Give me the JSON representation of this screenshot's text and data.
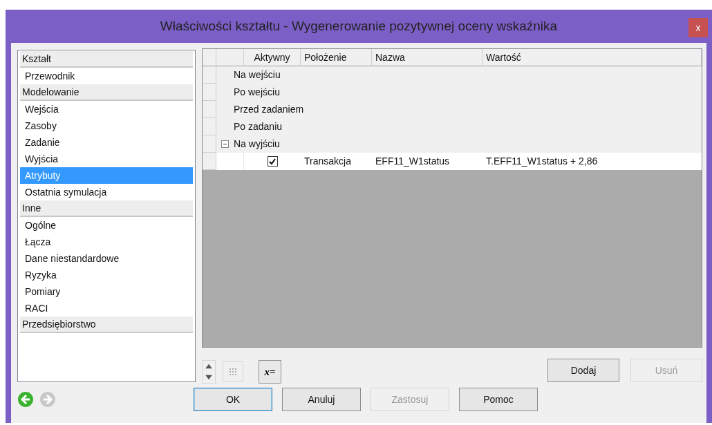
{
  "window": {
    "title": "Właściwości kształtu - Wygenerowanie pozytywnej oceny wskaźnika",
    "close": "x"
  },
  "sidebar": {
    "sections": [
      {
        "label": "Kształt",
        "items": [
          {
            "label": "Przewodnik",
            "selected": false
          }
        ]
      },
      {
        "label": "Modelowanie",
        "items": [
          {
            "label": "Wejścia",
            "selected": false
          },
          {
            "label": "Zasoby",
            "selected": false
          },
          {
            "label": "Zadanie",
            "selected": false
          },
          {
            "label": "Wyjścia",
            "selected": false
          },
          {
            "label": "Atrybuty",
            "selected": true
          },
          {
            "label": "Ostatnia symulacja",
            "selected": false
          }
        ]
      },
      {
        "label": "Inne",
        "items": [
          {
            "label": "Ogólne",
            "selected": false
          },
          {
            "label": "Łącza",
            "selected": false
          },
          {
            "label": "Dane niestandardowe",
            "selected": false
          },
          {
            "label": "Ryzyka",
            "selected": false
          },
          {
            "label": "Pomiary",
            "selected": false
          },
          {
            "label": "RACI",
            "selected": false
          }
        ]
      },
      {
        "label": "Przedsiębiorstwo"
      }
    ]
  },
  "nav": {
    "back_disabled": false,
    "forward_disabled": true
  },
  "grid": {
    "columns": [
      "Aktywny",
      "Położenie",
      "Nazwa",
      "Wartość"
    ],
    "groups": [
      {
        "label": "Na wejściu"
      },
      {
        "label": "Po wejściu"
      },
      {
        "label": "Przed zadaniem"
      },
      {
        "label": "Po zadaniu"
      },
      {
        "label": "Na wyjściu",
        "expanded": true,
        "rows": [
          {
            "checked": true,
            "position": "Transakcja",
            "name": "EFF11_W1status",
            "value": "T.EFF11_W1status + 2,86"
          }
        ]
      }
    ]
  },
  "toolbar": {
    "formula_button": "x=",
    "grid_disabled": true
  },
  "side_buttons": [
    {
      "label": "Dodaj",
      "disabled": false
    },
    {
      "label": "Usuń",
      "disabled": true
    }
  ],
  "dialog_buttons": [
    {
      "label": "OK",
      "disabled": false,
      "default": true
    },
    {
      "label": "Anuluj",
      "disabled": false,
      "default": false
    },
    {
      "label": "Zastosuj",
      "disabled": true,
      "default": false
    },
    {
      "label": "Pomoc",
      "disabled": false,
      "default": false
    }
  ]
}
